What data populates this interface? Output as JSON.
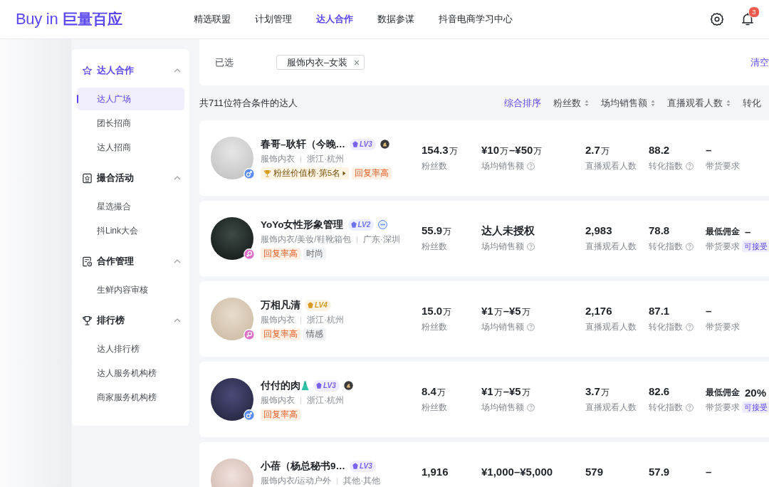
{
  "header": {
    "logo": {
      "latin": "Buy in",
      "chinese": "巨量百应"
    },
    "nav": [
      {
        "label": "精选联盟",
        "selected": false
      },
      {
        "label": "计划管理",
        "selected": false
      },
      {
        "label": "达人合作",
        "selected": true
      },
      {
        "label": "数据参谋",
        "selected": false
      },
      {
        "label": "抖音电商学习中心",
        "selected": false
      }
    ],
    "notification_count": "3"
  },
  "sidebar": {
    "groups": [
      {
        "title": "达人合作",
        "kind": "star",
        "expanded": true,
        "items": [
          {
            "label": "达人广场",
            "selected": true
          },
          {
            "label": "团长招商",
            "selected": false
          },
          {
            "label": "达人招商",
            "selected": false
          }
        ]
      },
      {
        "title": "撮合活动",
        "kind": "medal",
        "expanded": true,
        "items": [
          {
            "label": "星选撮合",
            "selected": false
          },
          {
            "label": "抖Link大会",
            "selected": false
          }
        ]
      },
      {
        "title": "合作管理",
        "kind": "document",
        "expanded": true,
        "items": [
          {
            "label": "生鲜内容审核",
            "selected": false
          }
        ]
      },
      {
        "title": "排行榜",
        "kind": "trophy",
        "expanded": true,
        "items": [
          {
            "label": "达人排行榜",
            "selected": false
          },
          {
            "label": "达人服务机构榜",
            "selected": false
          },
          {
            "label": "商家服务机构榜",
            "selected": false
          }
        ]
      }
    ]
  },
  "filters": {
    "label": "已选",
    "chips": [
      {
        "label": "服饰内衣–女装"
      }
    ],
    "clear": "清空"
  },
  "result_count": "共711位符合条件的达人",
  "sort_options": [
    {
      "label": "综合排序",
      "selected": true,
      "sortable": false
    },
    {
      "label": "粉丝数",
      "selected": false,
      "sortable": true
    },
    {
      "label": "场均销售额",
      "selected": false,
      "sortable": true
    },
    {
      "label": "直播观看人数",
      "selected": false,
      "sortable": true
    },
    {
      "label": "转化",
      "selected": false,
      "sortable": false
    }
  ],
  "creators": [
    {
      "name": "春哥–耿轩（今晚…",
      "gender_badge": {
        "kind": "male"
      },
      "lv": {
        "text": "LV3",
        "color": "#7b61f0"
      },
      "badge": {
        "kind": "emblem"
      },
      "category": "服饰内衣",
      "location": "浙江·杭州",
      "tags": [
        {
          "kind": "rank",
          "text": "粉丝价值榜·第5名"
        },
        {
          "kind": "highlight",
          "text": "回复率高"
        }
      ],
      "stats": [
        {
          "value": [
            {
              "kind": "main",
              "text": "154.3"
            },
            {
              "kind": "unit",
              "text": "万"
            }
          ],
          "label": "粉丝数",
          "help": false
        },
        {
          "value": [
            {
              "kind": "main",
              "text": "¥10"
            },
            {
              "kind": "unit",
              "text": "万"
            },
            {
              "kind": "main",
              "text": "–¥50"
            },
            {
              "kind": "unit",
              "text": "万"
            }
          ],
          "label": "场均销售额",
          "help": true
        },
        {
          "value": [
            {
              "kind": "main",
              "text": "2.7"
            },
            {
              "kind": "unit",
              "text": "万"
            }
          ],
          "label": "直播观看人数",
          "help": false
        },
        {
          "value": [
            {
              "kind": "main",
              "text": "88.2"
            }
          ],
          "label": "转化指数",
          "help": true
        }
      ],
      "requirement": {
        "kind": "simple",
        "value": "–",
        "label": "带货要求"
      }
    },
    {
      "name": "YoYo女性形象管理",
      "gender_badge": {
        "kind": "female"
      },
      "lv": {
        "text": "LV2",
        "color": "#6f72f2"
      },
      "badge": {
        "kind": "chat"
      },
      "category": "服饰内衣/美妆/鞋靴箱包",
      "location": "广东·深圳",
      "tags": [
        {
          "kind": "highlight",
          "text": "回复率高"
        },
        {
          "kind": "plain",
          "text": "时尚"
        }
      ],
      "stats": [
        {
          "value": [
            {
              "kind": "main",
              "text": "55.9"
            },
            {
              "kind": "unit",
              "text": "万"
            }
          ],
          "label": "粉丝数",
          "help": false
        },
        {
          "value": [
            {
              "kind": "main",
              "text": "达人未授权"
            }
          ],
          "label": "场均销售额",
          "help": true
        },
        {
          "value": [
            {
              "kind": "main",
              "text": "2,983"
            }
          ],
          "label": "直播观看人数",
          "help": false
        },
        {
          "value": [
            {
              "kind": "main",
              "text": "78.8"
            }
          ],
          "label": "转化指数",
          "help": true
        }
      ],
      "requirement": {
        "kind": "commission",
        "commission_label": "最低佣金",
        "commission": "–",
        "label": "带货要求",
        "tag": "可接受"
      }
    },
    {
      "name": "万相凡清",
      "gender_badge": {
        "kind": "female"
      },
      "lv": {
        "text": "LV4",
        "color": "#d49a22"
      },
      "category": "服饰内衣",
      "location": "浙江·杭州",
      "tags": [
        {
          "kind": "highlight",
          "text": "回复率高"
        },
        {
          "kind": "plain",
          "text": "情感"
        }
      ],
      "stats": [
        {
          "value": [
            {
              "kind": "main",
              "text": "15.0"
            },
            {
              "kind": "unit",
              "text": "万"
            }
          ],
          "label": "粉丝数",
          "help": false
        },
        {
          "value": [
            {
              "kind": "main",
              "text": "¥1"
            },
            {
              "kind": "unit",
              "text": "万"
            },
            {
              "kind": "main",
              "text": "–¥5"
            },
            {
              "kind": "unit",
              "text": "万"
            }
          ],
          "label": "场均销售额",
          "help": true
        },
        {
          "value": [
            {
              "kind": "main",
              "text": "2,176"
            }
          ],
          "label": "直播观看人数",
          "help": false
        },
        {
          "value": [
            {
              "kind": "main",
              "text": "87.1"
            }
          ],
          "label": "转化指数",
          "help": true
        }
      ],
      "requirement": {
        "kind": "simple",
        "value": "–",
        "label": "带货要求"
      }
    },
    {
      "name": "付付的肉",
      "name_icon": {
        "kind": "dress"
      },
      "gender_badge": {
        "kind": "male"
      },
      "lv": {
        "text": "LV3",
        "color": "#7b61f0"
      },
      "badge": {
        "kind": "emblem"
      },
      "category": "服饰内衣",
      "location": "浙江·杭州",
      "tags": [
        {
          "kind": "highlight",
          "text": "回复率高"
        }
      ],
      "stats": [
        {
          "value": [
            {
              "kind": "main",
              "text": "8.4"
            },
            {
              "kind": "unit",
              "text": "万"
            }
          ],
          "label": "粉丝数",
          "help": false
        },
        {
          "value": [
            {
              "kind": "main",
              "text": "¥1"
            },
            {
              "kind": "unit",
              "text": "万"
            },
            {
              "kind": "main",
              "text": "–¥5"
            },
            {
              "kind": "unit",
              "text": "万"
            }
          ],
          "label": "场均销售额",
          "help": true
        },
        {
          "value": [
            {
              "kind": "main",
              "text": "3.7"
            },
            {
              "kind": "unit",
              "text": "万"
            }
          ],
          "label": "直播观看人数",
          "help": false
        },
        {
          "value": [
            {
              "kind": "main",
              "text": "82.6"
            }
          ],
          "label": "转化指数",
          "help": true
        }
      ],
      "requirement": {
        "kind": "commission",
        "commission_label": "最低佣金",
        "commission": "20%",
        "label": "带货要求",
        "tag": "可接受"
      }
    },
    {
      "name": "小蓓（杨总秘书9…",
      "lv": {
        "text": "LV3",
        "color": "#7b61f0"
      },
      "category": "服饰内衣/运动户外",
      "location": "其他·其他",
      "stats": [
        {
          "value": [
            {
              "kind": "main",
              "text": "1,916"
            }
          ]
        },
        {
          "value": [
            {
              "kind": "main",
              "text": "¥1,000–¥5,000"
            }
          ]
        },
        {
          "value": [
            {
              "kind": "main",
              "text": "579"
            }
          ]
        },
        {
          "value": [
            {
              "kind": "main",
              "text": "57.9"
            }
          ]
        }
      ],
      "requirement": {
        "kind": "simple",
        "value": "–"
      }
    }
  ]
}
